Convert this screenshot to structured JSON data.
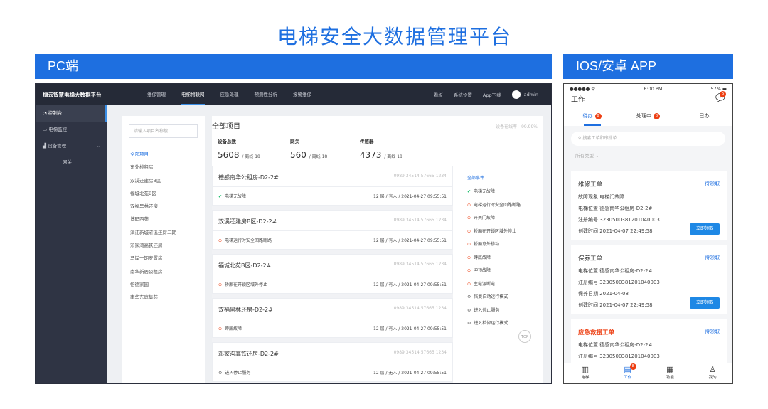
{
  "page_title": "电梯安全大数据管理平台",
  "bands": {
    "pc": "PC端",
    "app": "IOS/安卓 APP"
  },
  "pc": {
    "brand": "梯云智慧电梯大数据平台",
    "nav": [
      "维保管理",
      "电梯物联网",
      "应急处理",
      "预测性分析",
      "报警维保"
    ],
    "nav_active": "电梯物联网",
    "right_menu": [
      "看板",
      "系统设置",
      "App下载"
    ],
    "user": "admin",
    "sidebar": [
      "控制台",
      "电梯监控",
      "设备管理"
    ],
    "sidebar_sub": "网关",
    "search_placeholder": "请输入项目名称搜",
    "projects": [
      "全部项目",
      "东外楼租房",
      "双溪还建房B区",
      "福城北苑B区",
      "双福黑林还房",
      "博码西苑",
      "滨江新城浒溪还房二期",
      "邓家湾高铁还房",
      "马岸一期安置房",
      "南华新居公租房",
      "恰德家园",
      "南华东庭集苑"
    ],
    "main_title": "全部项目",
    "online_rate": "设备在线率：99.99%",
    "stats": [
      {
        "label": "设备总数",
        "value": "5608",
        "offline": "/ 离线 18"
      },
      {
        "label": "网关",
        "value": "560",
        "offline": "/ 离线 18"
      },
      {
        "label": "传感器",
        "value": "4373",
        "offline": "/ 离线 18"
      }
    ],
    "cards": [
      {
        "name": "德感南华公租房-D2-2#",
        "code": "0989 34514 57665 1234",
        "status": "电梯无故障",
        "icon": "✔",
        "meta": "12 层 / 有人 / 2021-04-27 09:55:51"
      },
      {
        "name": "双溪还建房B区-D2-2#",
        "code": "0989 34514 57665 1234",
        "status": "电梯运行时安全回路断路",
        "icon": "⊙",
        "meta": "12 层 / 有人 / 2021-04-27 09:55:51"
      },
      {
        "name": "福城北苑B区-D2-2#",
        "code": "0989 34514 57665 1234",
        "status": "轿厢在开锁区域外停止",
        "icon": "⊙",
        "meta": "12 层 / 有人 / 2021-04-27 09:55:51"
      },
      {
        "name": "双福黑林还房-D2-2#",
        "code": "0989 34514 57665 1234",
        "status": "蹲底故障",
        "icon": "⊙",
        "meta": "12 层 / 有人 / 2021-04-27 09:55:51"
      },
      {
        "name": "邓家沟高铁还房-D2-2#",
        "code": "0989 34514 57665 1234",
        "status": "进入停止服务",
        "icon": "⚙",
        "meta": "12 层 / 无人 / 2021-04-27 09:55:51"
      }
    ],
    "events_title": "全部事件",
    "events": [
      {
        "icon": "✔",
        "text": "电梯无故障",
        "kind": "ok"
      },
      {
        "icon": "⊙",
        "text": "电梯运行时安全回路断路",
        "kind": "warn"
      },
      {
        "icon": "⊙",
        "text": "开关门故障",
        "kind": "warn"
      },
      {
        "icon": "⊙",
        "text": "轿厢在开锁区域外停止",
        "kind": "warn"
      },
      {
        "icon": "⊙",
        "text": "轿厢意外移动",
        "kind": "warn"
      },
      {
        "icon": "⊙",
        "text": "蹲底故障",
        "kind": "warn"
      },
      {
        "icon": "⊙",
        "text": "冲顶故障",
        "kind": "warn"
      },
      {
        "icon": "⊙",
        "text": "主电源断电",
        "kind": "warn"
      },
      {
        "icon": "⚙",
        "text": "恢复自动运行模式",
        "kind": "gray"
      },
      {
        "icon": "⚙",
        "text": "进入停止服务",
        "kind": "gray"
      },
      {
        "icon": "⚙",
        "text": "进入检修运行模式",
        "kind": "gray"
      }
    ],
    "top_label": "TOP"
  },
  "app": {
    "carrier": "●●●●● ᯤ",
    "time": "6:00 PM",
    "battery": "57%",
    "header": "工作",
    "header_badge": "5",
    "tabs": [
      {
        "label": "待办",
        "badge": "8"
      },
      {
        "label": "处理中",
        "badge": "8"
      },
      {
        "label": "已办",
        "badge": ""
      }
    ],
    "search_placeholder": "搜索工单和审批单",
    "filter": "所有类型",
    "orders": [
      {
        "title": "维修工单",
        "action": "待领取",
        "rows": [
          "故障现象  电梯门故障",
          "电梯位置  德感南华公租房-D2-2#",
          "注册编号  3230500381201040003",
          "创建时间  2021-04-07 22:49:58"
        ],
        "button": "立即领取"
      },
      {
        "title": "保养工单",
        "action": "待领取",
        "rows": [
          "电梯位置  德感南华公租房-D2-2#",
          "注册编号  3230500381201040003",
          "保养日期  2021-04-08",
          "创建时间  2021-04-07 22:49:58"
        ],
        "button": "立即领取"
      },
      {
        "title": "应急救援工单",
        "action": "待领取",
        "rows": [
          "电梯位置  德感南华公租房-D2-2#",
          "注册编号  3230500381201040003"
        ],
        "button": ""
      }
    ],
    "tabbar": [
      {
        "label": "电梯",
        "icon": "▥"
      },
      {
        "label": "工作",
        "icon": "▤",
        "badge": "8"
      },
      {
        "label": "功能",
        "icon": "▦"
      },
      {
        "label": "我的",
        "icon": "♙"
      }
    ]
  }
}
